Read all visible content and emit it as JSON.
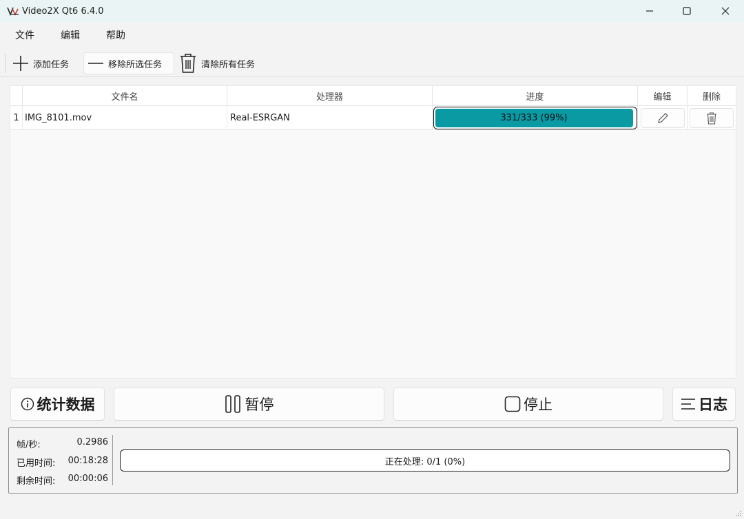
{
  "window": {
    "title": "Video2X Qt6 6.4.0"
  },
  "menu": {
    "file": "文件",
    "edit": "编辑",
    "help": "帮助"
  },
  "toolbar": {
    "add": "添加任务",
    "remove": "移除所选任务",
    "clear": "清除所有任务"
  },
  "table": {
    "headers": {
      "file": "文件名",
      "processor": "处理器",
      "progress": "进度",
      "edit": "编辑",
      "delete": "删除"
    },
    "rows": [
      {
        "index": "1",
        "file": "IMG_8101.mov",
        "processor": "Real-ESRGAN",
        "progress_text": "331/333 (99%)",
        "progress_fraction": 0.99
      }
    ]
  },
  "buttons": {
    "stats": "统计数据",
    "pause": "暂停",
    "stop": "停止",
    "log": "日志"
  },
  "stats": {
    "fps_label": "帧/秒:",
    "fps_value": "0.2986",
    "elapsed_label": "已用时间:",
    "elapsed_value": "00:18:28",
    "remaining_label": "剩余时间:",
    "remaining_value": "00:00:06",
    "overall": "正在处理: 0/1 (0%)"
  },
  "colors": {
    "accent": "#0a9aa3",
    "titlebar": "#ebf4f4"
  },
  "icons": [
    "app-logo-icon",
    "minimize-icon",
    "maximize-icon",
    "close-icon",
    "plus-icon",
    "minus-icon",
    "trash-icon",
    "pencil-icon",
    "info-icon",
    "pause-icon",
    "stop-icon",
    "log-icon"
  ]
}
